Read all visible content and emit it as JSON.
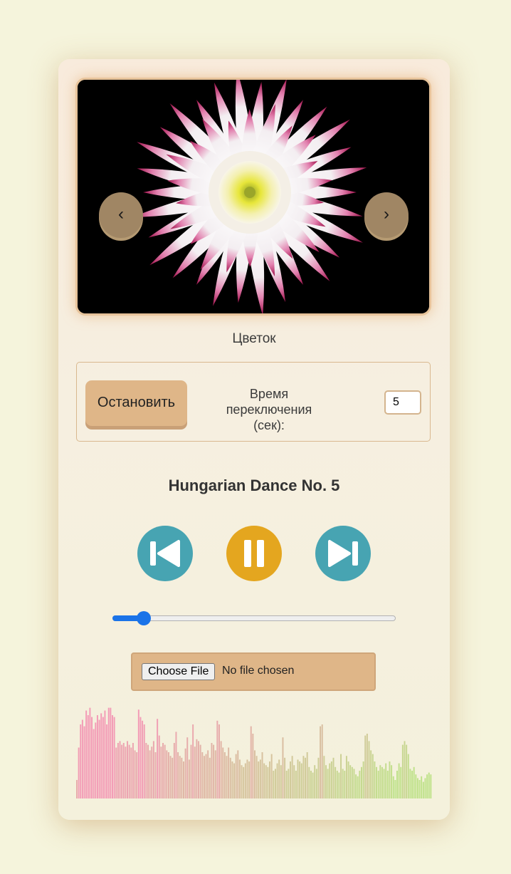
{
  "slider": {
    "prev_symbol": "‹",
    "next_symbol": "›",
    "caption": "Цветок"
  },
  "controls": {
    "stop_label": "Остановить",
    "interval_label": "Время переключения (сек):",
    "interval_value": "5"
  },
  "player": {
    "track_title": "Hungarian Dance No. 5",
    "progress_percent": 11,
    "choose_file_label": "Choose File",
    "file_status": "No file chosen"
  },
  "visualizer": {
    "bar_levels": [
      0.2,
      0.55,
      0.8,
      0.85,
      0.78,
      0.95,
      0.9,
      0.98,
      0.88,
      0.75,
      0.82,
      0.9,
      0.85,
      0.92,
      0.88,
      0.95,
      0.8,
      0.98,
      0.98,
      0.9,
      0.88,
      0.55,
      0.6,
      0.62,
      0.58,
      0.6,
      0.56,
      0.62,
      0.58,
      0.55,
      0.6,
      0.52,
      0.5,
      0.96,
      0.88,
      0.84,
      0.8,
      0.6,
      0.58,
      0.52,
      0.56,
      0.62,
      0.5,
      0.86,
      0.68,
      0.56,
      0.6,
      0.58,
      0.52,
      0.5,
      0.46,
      0.44,
      0.6,
      0.72,
      0.5,
      0.46,
      0.44,
      0.4,
      0.54,
      0.66,
      0.42,
      0.58,
      0.8,
      0.56,
      0.64,
      0.62,
      0.58,
      0.5,
      0.46,
      0.48,
      0.52,
      0.44,
      0.6,
      0.58,
      0.52,
      0.84,
      0.8,
      0.62,
      0.55,
      0.5,
      0.46,
      0.55,
      0.44,
      0.4,
      0.38,
      0.48,
      0.52,
      0.42,
      0.36,
      0.34,
      0.38,
      0.42,
      0.4,
      0.78,
      0.7,
      0.52,
      0.46,
      0.4,
      0.42,
      0.5,
      0.38,
      0.36,
      0.34,
      0.4,
      0.48,
      0.3,
      0.32,
      0.38,
      0.42,
      0.36,
      0.66,
      0.44,
      0.3,
      0.32,
      0.4,
      0.46,
      0.36,
      0.3,
      0.42,
      0.4,
      0.38,
      0.46,
      0.44,
      0.5,
      0.34,
      0.3,
      0.28,
      0.36,
      0.32,
      0.44,
      0.78,
      0.8,
      0.46,
      0.36,
      0.32,
      0.38,
      0.4,
      0.44,
      0.34,
      0.3,
      0.28,
      0.48,
      0.32,
      0.3,
      0.46,
      0.4,
      0.36,
      0.34,
      0.32,
      0.26,
      0.24,
      0.3,
      0.34,
      0.4,
      0.68,
      0.7,
      0.62,
      0.52,
      0.48,
      0.4,
      0.34,
      0.3,
      0.36,
      0.34,
      0.32,
      0.38,
      0.3,
      0.4,
      0.36,
      0.24,
      0.2,
      0.3,
      0.38,
      0.34,
      0.58,
      0.62,
      0.58,
      0.48,
      0.32,
      0.3,
      0.34,
      0.26,
      0.22,
      0.2,
      0.24,
      0.18,
      0.22,
      0.26,
      0.28,
      0.26
    ],
    "warm_color": "#f39bb6",
    "cool_color": "#bfe28a"
  },
  "colors": {
    "accent": "#dfb688",
    "teal_button": "#47a4b2",
    "pause_button": "#e4a61f",
    "progress": "#1a73e8"
  },
  "icons": {
    "prev": "skip-previous-icon",
    "pause": "pause-icon",
    "next": "skip-next-icon"
  }
}
